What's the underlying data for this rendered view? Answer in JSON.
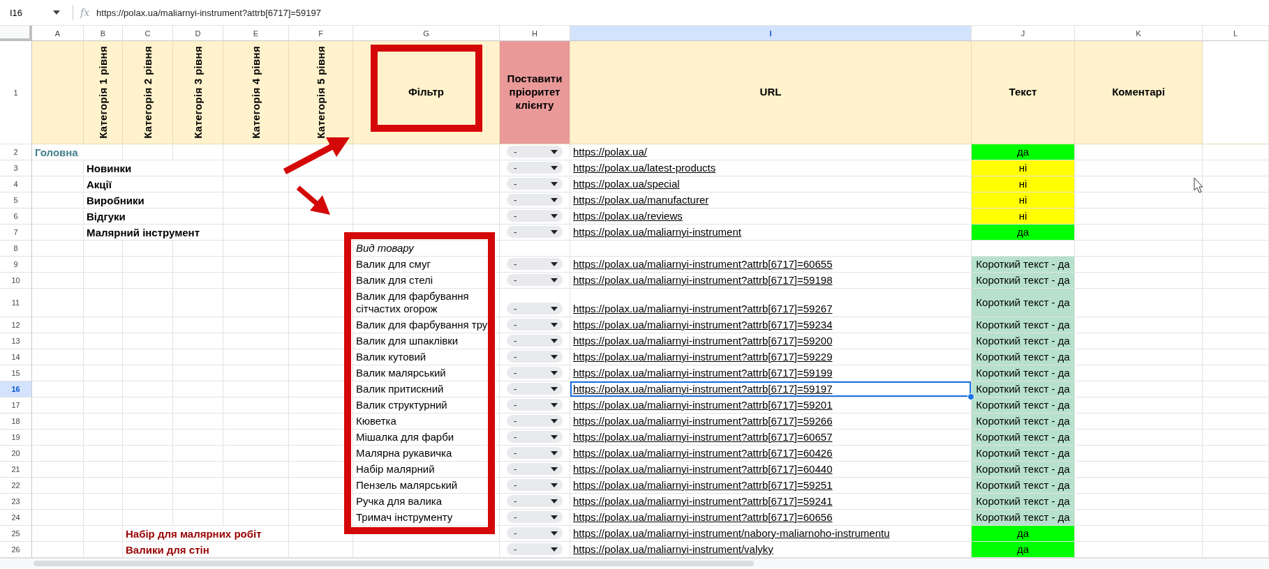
{
  "name_box": "I16",
  "fx_label": "fx",
  "formula": "https://polax.ua/maliarnyi-instrument?attrb[6717]=59197",
  "columns": [
    {
      "label": "A",
      "selected": false
    },
    {
      "label": "B",
      "selected": false
    },
    {
      "label": "C",
      "selected": false
    },
    {
      "label": "D",
      "selected": false
    },
    {
      "label": "E",
      "selected": false
    },
    {
      "label": "F",
      "selected": false
    },
    {
      "label": "G",
      "selected": false
    },
    {
      "label": "H",
      "selected": false
    },
    {
      "label": "I",
      "selected": true
    },
    {
      "label": "J",
      "selected": false
    },
    {
      "label": "K",
      "selected": false
    },
    {
      "label": "L",
      "selected": false
    }
  ],
  "header_row": {
    "number": "1",
    "cells": [
      {
        "kind": "blank",
        "color": "#fff2cc"
      },
      {
        "kind": "vertical",
        "text": "Категорія 1 рівня",
        "color": "#fff2cc"
      },
      {
        "kind": "vertical",
        "text": "Категорія 2 рівня",
        "color": "#fff2cc"
      },
      {
        "kind": "vertical",
        "text": "Категорія 3 рівня",
        "color": "#fff2cc"
      },
      {
        "kind": "vertical",
        "text": "Категорія 4 рівня",
        "color": "#fff2cc"
      },
      {
        "kind": "vertical",
        "text": "Категорія 5 рівня",
        "color": "#fff2cc"
      },
      {
        "kind": "horizontal",
        "text": "Фільтр",
        "color": "#fff2cc"
      },
      {
        "kind": "horizontal",
        "text": "Поставити пріоритет клієнту",
        "color": "#ea9999"
      },
      {
        "kind": "horizontal",
        "text": "URL",
        "color": "#fff2cc"
      },
      {
        "kind": "horizontal",
        "text": "Текст",
        "color": "#fff2cc"
      },
      {
        "kind": "horizontal",
        "text": "Коментарі",
        "color": "#fff2cc"
      }
    ]
  },
  "rows": [
    {
      "number": "2",
      "selected": false,
      "category": {
        "kind": "home",
        "text": "Головна"
      },
      "priority": "-",
      "url": "https://polax.ua/",
      "status": {
        "text": "да",
        "color": "#00ff00"
      }
    },
    {
      "number": "3",
      "selected": false,
      "category": {
        "kind": "level1",
        "text": "Новинки"
      },
      "priority": "-",
      "url": "https://polax.ua/latest-products",
      "status": {
        "text": "ні",
        "color": "#ffff00"
      }
    },
    {
      "number": "4",
      "selected": false,
      "category": {
        "kind": "level1",
        "text": "Акції"
      },
      "priority": "-",
      "url": "https://polax.ua/special",
      "status": {
        "text": "ні",
        "color": "#ffff00"
      }
    },
    {
      "number": "5",
      "selected": false,
      "category": {
        "kind": "level1",
        "text": "Виробники"
      },
      "priority": "-",
      "url": "https://polax.ua/manufacturer",
      "status": {
        "text": "ні",
        "color": "#ffff00"
      }
    },
    {
      "number": "6",
      "selected": false,
      "category": {
        "kind": "level1",
        "text": "Відгуки"
      },
      "priority": "-",
      "url": "https://polax.ua/reviews",
      "status": {
        "text": "ні",
        "color": "#ffff00"
      }
    },
    {
      "number": "7",
      "selected": false,
      "category": {
        "kind": "level1",
        "text": "Малярний інструмент"
      },
      "priority": "-",
      "url": "https://polax.ua/maliarnyi-instrument",
      "status": {
        "text": "да",
        "color": "#00ff00"
      }
    },
    {
      "number": "8",
      "selected": false,
      "filter": {
        "kind": "heading",
        "text": "Вид товару"
      }
    },
    {
      "number": "9",
      "selected": false,
      "filter": {
        "kind": "item",
        "text": "Валик для смуг"
      },
      "priority": "-",
      "url": "https://polax.ua/maliarnyi-instrument?attrb[6717]=60655",
      "status": {
        "text": "Короткий текст - да",
        "color": "#b7e1cd"
      }
    },
    {
      "number": "10",
      "selected": false,
      "filter": {
        "kind": "item",
        "text": "Валик для стелі"
      },
      "priority": "-",
      "url": "https://polax.ua/maliarnyi-instrument?attrb[6717]=59198",
      "status": {
        "text": "Короткий текст - да",
        "color": "#b7e1cd"
      }
    },
    {
      "number": "11",
      "selected": false,
      "filter": {
        "kind": "item",
        "text": "Валик для фарбування сітчастих огорож"
      },
      "priority": "-",
      "url": "https://polax.ua/maliarnyi-instrument?attrb[6717]=59267",
      "status": {
        "text": "Короткий текст - да",
        "color": "#b7e1cd"
      }
    },
    {
      "number": "12",
      "selected": false,
      "filter": {
        "kind": "item",
        "text": "Валик для фарбування тру"
      },
      "priority": "-",
      "url": "https://polax.ua/maliarnyi-instrument?attrb[6717]=59234",
      "status": {
        "text": "Короткий текст - да",
        "color": "#b7e1cd"
      }
    },
    {
      "number": "13",
      "selected": false,
      "filter": {
        "kind": "item",
        "text": "Валик для шпаклівки"
      },
      "priority": "-",
      "url": "https://polax.ua/maliarnyi-instrument?attrb[6717]=59200",
      "status": {
        "text": "Короткий текст - да",
        "color": "#b7e1cd"
      }
    },
    {
      "number": "14",
      "selected": false,
      "filter": {
        "kind": "item",
        "text": "Валик кутовий"
      },
      "priority": "-",
      "url": "https://polax.ua/maliarnyi-instrument?attrb[6717]=59229",
      "status": {
        "text": "Короткий текст - да",
        "color": "#b7e1cd"
      }
    },
    {
      "number": "15",
      "selected": false,
      "filter": {
        "kind": "item",
        "text": "Валик малярський"
      },
      "priority": "-",
      "url": "https://polax.ua/maliarnyi-instrument?attrb[6717]=59199",
      "status": {
        "text": "Короткий текст - да",
        "color": "#b7e1cd"
      }
    },
    {
      "number": "16",
      "selected": true,
      "filter": {
        "kind": "item",
        "text": "Валик притискний"
      },
      "priority": "-",
      "url": "https://polax.ua/maliarnyi-instrument?attrb[6717]=59197",
      "status": {
        "text": "Короткий текст - да",
        "color": "#b7e1cd"
      }
    },
    {
      "number": "17",
      "selected": false,
      "filter": {
        "kind": "item",
        "text": "Валик структурний"
      },
      "priority": "-",
      "url": "https://polax.ua/maliarnyi-instrument?attrb[6717]=59201",
      "status": {
        "text": "Короткий текст - да",
        "color": "#b7e1cd"
      }
    },
    {
      "number": "18",
      "selected": false,
      "filter": {
        "kind": "item",
        "text": "Кюветка"
      },
      "priority": "-",
      "url": "https://polax.ua/maliarnyi-instrument?attrb[6717]=59266",
      "status": {
        "text": "Короткий текст - да",
        "color": "#b7e1cd"
      }
    },
    {
      "number": "19",
      "selected": false,
      "filter": {
        "kind": "item",
        "text": "Мішалка для фарби"
      },
      "priority": "-",
      "url": "https://polax.ua/maliarnyi-instrument?attrb[6717]=60657",
      "status": {
        "text": "Короткий текст - да",
        "color": "#b7e1cd"
      }
    },
    {
      "number": "20",
      "selected": false,
      "filter": {
        "kind": "item",
        "text": "Малярна рукавичка"
      },
      "priority": "-",
      "url": "https://polax.ua/maliarnyi-instrument?attrb[6717]=60426",
      "status": {
        "text": "Короткий текст - да",
        "color": "#b7e1cd"
      }
    },
    {
      "number": "21",
      "selected": false,
      "filter": {
        "kind": "item",
        "text": "Набір малярний"
      },
      "priority": "-",
      "url": "https://polax.ua/maliarnyi-instrument?attrb[6717]=60440",
      "status": {
        "text": "Короткий текст - да",
        "color": "#b7e1cd"
      }
    },
    {
      "number": "22",
      "selected": false,
      "filter": {
        "kind": "item",
        "text": "Пензель малярський"
      },
      "priority": "-",
      "url": "https://polax.ua/maliarnyi-instrument?attrb[6717]=59251",
      "status": {
        "text": "Короткий текст - да",
        "color": "#b7e1cd"
      }
    },
    {
      "number": "23",
      "selected": false,
      "filter": {
        "kind": "item",
        "text": "Ручка для валика"
      },
      "priority": "-",
      "url": "https://polax.ua/maliarnyi-instrument?attrb[6717]=59241",
      "status": {
        "text": "Короткий текст - да",
        "color": "#b7e1cd"
      }
    },
    {
      "number": "24",
      "selected": false,
      "filter": {
        "kind": "item",
        "text": "Тримач інструменту"
      },
      "priority": "-",
      "url": "https://polax.ua/maliarnyi-instrument?attrb[6717]=60656",
      "status": {
        "text": "Короткий текст - да",
        "color": "#b7e1cd"
      }
    },
    {
      "number": "25",
      "selected": false,
      "category": {
        "kind": "level2",
        "text": "Набір для малярних робіт"
      },
      "priority": "-",
      "url": "https://polax.ua/maliarnyi-instrument/nabory-maliarnoho-instrumentu",
      "status": {
        "text": "да",
        "color": "#00ff00"
      }
    },
    {
      "number": "26",
      "selected": false,
      "category": {
        "kind": "level2",
        "text": "Валики для стін"
      },
      "priority": "-",
      "url": "https://polax.ua/maliarnyi-instrument/valyky",
      "status": {
        "text": "да",
        "color": "#00ff00"
      }
    }
  ]
}
